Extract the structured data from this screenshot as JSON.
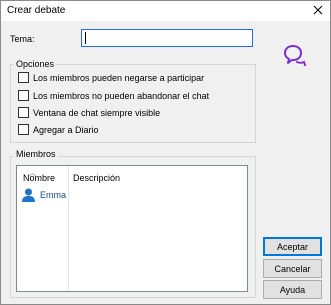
{
  "window": {
    "title": "Crear debate",
    "close_symbol": "✕"
  },
  "topic": {
    "label": "Tema:",
    "value": ""
  },
  "options": {
    "legend": "Opciones",
    "items": [
      {
        "label": "Los miembros pueden negarse a participar",
        "checked": false
      },
      {
        "label": "Los miembros no pueden abandonar el chat",
        "checked": false
      },
      {
        "label": "Ventana de chat siempre visible",
        "checked": false
      },
      {
        "label": "Agregar a Diario",
        "checked": false
      }
    ]
  },
  "members": {
    "legend": "Miembros",
    "columns": [
      "Nombre",
      "Descripción"
    ],
    "rows": [
      {
        "name": "Emma",
        "description": ""
      }
    ]
  },
  "buttons": {
    "accept": "Aceptar",
    "cancel": "Cancelar",
    "help": "Ayuda"
  },
  "colors": {
    "accent": "#0078d7",
    "chat_icon": "#7b2fd0",
    "user_icon": "#1e73c8"
  },
  "icons": {
    "chat": "chat-bubbles-icon",
    "user": "user-icon",
    "close": "close-icon"
  }
}
